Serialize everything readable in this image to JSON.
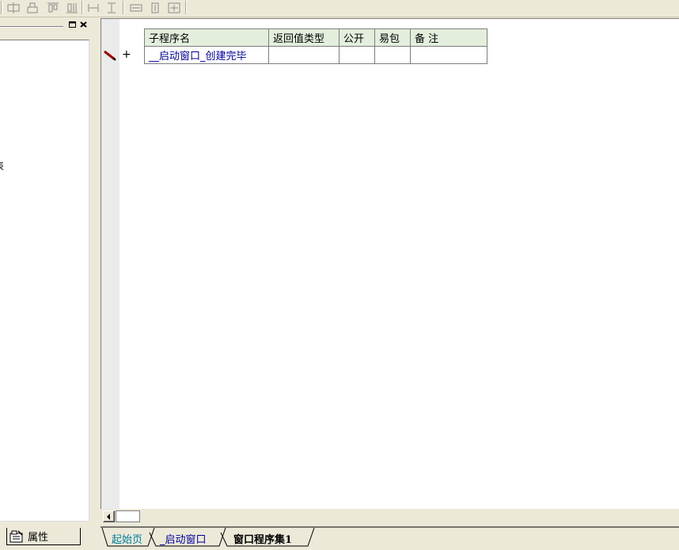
{
  "toolbar": {
    "buttons": [
      "align-left-icon",
      "align-center-icon",
      "align-top-icon",
      "align-bottom-icon",
      "space-horiz-icon",
      "space-vert-icon",
      "same-width-icon",
      "same-height-icon",
      "same-size-icon"
    ]
  },
  "left_panel": {
    "cut_text": "表",
    "bottom_tab_label": "属性"
  },
  "subroutine_table": {
    "headers": [
      "子程序名",
      "返回值类型",
      "公开",
      "易包",
      "备 注"
    ],
    "rows": [
      {
        "name": "__启动窗口_创建完毕",
        "return_type": "",
        "public": "",
        "easy_pkg": "",
        "remark": ""
      }
    ]
  },
  "gutter": {
    "expand_symbol": "+"
  },
  "doc_tabs": [
    {
      "label": "起始页"
    },
    {
      "label": "_启动窗口"
    },
    {
      "label": "窗口程序集1"
    }
  ],
  "colors": {
    "header_bg": "#e3eedd",
    "link_text": "#0000a0",
    "start_tab_text": "#0080a0",
    "pen_red": "#a00000"
  }
}
